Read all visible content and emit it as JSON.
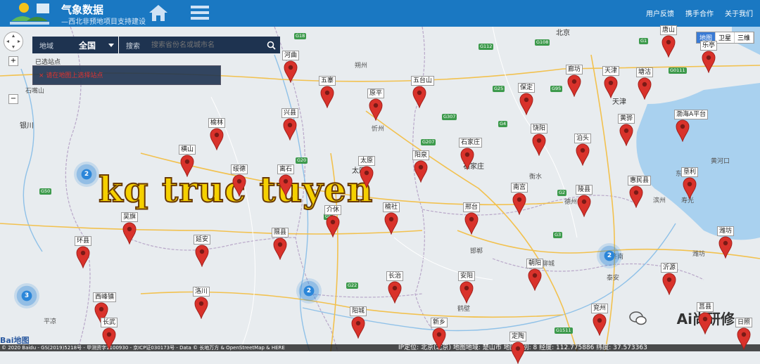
{
  "header": {
    "title": "气象数据",
    "subtitle": "—西北非预地项目支持建设",
    "links": [
      "用户反馈",
      "携手合作",
      "关于我们"
    ]
  },
  "search": {
    "region_label": "地域",
    "region_value": "全国",
    "search_label": "搜索",
    "placeholder": "搜索省份名或城市名",
    "selected_title": "已选站点",
    "selected_item": "×  请在地图上选择站点"
  },
  "map_type": [
    "地图",
    "卫星",
    "三维"
  ],
  "zoom": {
    "in": "+",
    "out": "−"
  },
  "cities": [
    {
      "name": "北京",
      "big": true
    },
    {
      "name": "天津",
      "big": true
    },
    {
      "name": "银川",
      "big": true
    },
    {
      "name": "太原",
      "big": true
    },
    {
      "name": "石家庄",
      "big": true
    },
    {
      "name": "忻州"
    },
    {
      "name": "衡水"
    },
    {
      "name": "德州"
    },
    {
      "name": "滨州"
    },
    {
      "name": "邯郸"
    },
    {
      "name": "聊城"
    },
    {
      "name": "济南"
    },
    {
      "name": "泰安"
    },
    {
      "name": "鹤壁"
    },
    {
      "name": "平凉"
    },
    {
      "name": "石嘴山"
    },
    {
      "name": "朔州"
    },
    {
      "name": "东营"
    },
    {
      "name": "黄河口"
    },
    {
      "name": "潍坊"
    },
    {
      "name": "寿光"
    }
  ],
  "roads": [
    "G18",
    "G112",
    "G108",
    "G1",
    "G0111",
    "G25",
    "G95",
    "G5",
    "G22",
    "G307",
    "G4",
    "G207",
    "G20",
    "G2",
    "G3",
    "G1511",
    "G50"
  ],
  "stations": [
    {
      "label": "河曲"
    },
    {
      "label": "五寨"
    },
    {
      "label": "原平"
    },
    {
      "label": "五台山"
    },
    {
      "label": "保定"
    },
    {
      "label": "廊坊"
    },
    {
      "label": "天津"
    },
    {
      "label": "塘沽"
    },
    {
      "label": "唐山"
    },
    {
      "label": "乐亭"
    },
    {
      "label": "兴县"
    },
    {
      "label": "榆林"
    },
    {
      "label": "横山"
    },
    {
      "label": "饶阳"
    },
    {
      "label": "泊头"
    },
    {
      "label": "黄骅"
    },
    {
      "label": "渤海A平台"
    },
    {
      "label": "绥德"
    },
    {
      "label": "离石"
    },
    {
      "label": "太原"
    },
    {
      "label": "阳泉"
    },
    {
      "label": "石家庄"
    },
    {
      "label": "南宫"
    },
    {
      "label": "陵县"
    },
    {
      "label": "惠民县"
    },
    {
      "label": "垦利"
    },
    {
      "label": "吴旗"
    },
    {
      "label": "介休"
    },
    {
      "label": "榆社"
    },
    {
      "label": "邢台"
    },
    {
      "label": "隰县"
    },
    {
      "label": "延安"
    },
    {
      "label": "环县"
    },
    {
      "label": "潍坊"
    },
    {
      "label": "朝阳"
    },
    {
      "label": "安阳"
    },
    {
      "label": "沂源"
    },
    {
      "label": "洛川"
    },
    {
      "label": "长治"
    },
    {
      "label": "西峰镇"
    },
    {
      "label": "阳城"
    },
    {
      "label": "长武"
    },
    {
      "label": "新乡"
    },
    {
      "label": "定陶"
    },
    {
      "label": "兖州"
    },
    {
      "label": "莒县"
    },
    {
      "label": "日照"
    }
  ],
  "clusters": [
    "2",
    "2",
    "2",
    "3"
  ],
  "overlay_text": "kq truc tuyen",
  "wechat_text": "Ai尚研修",
  "baidu_logo": "Bai地图",
  "bottom": {
    "copyright": "© 2020 Baidu - GS(2019)5218号 - 甲测资字1100930 - 京ICP证030173号 - Data © 长地万方 & OpenStreetMap & HERE",
    "info": "IP定位: 北京(北京)    地图地域: 楚山市    地图级别: 8    经度: 112.775886  纬度: 37.573363"
  },
  "colors": {
    "header": "#1a78c2",
    "marker": "#d9322b",
    "cluster": "#2b86d9",
    "panel": "#1e3350"
  }
}
